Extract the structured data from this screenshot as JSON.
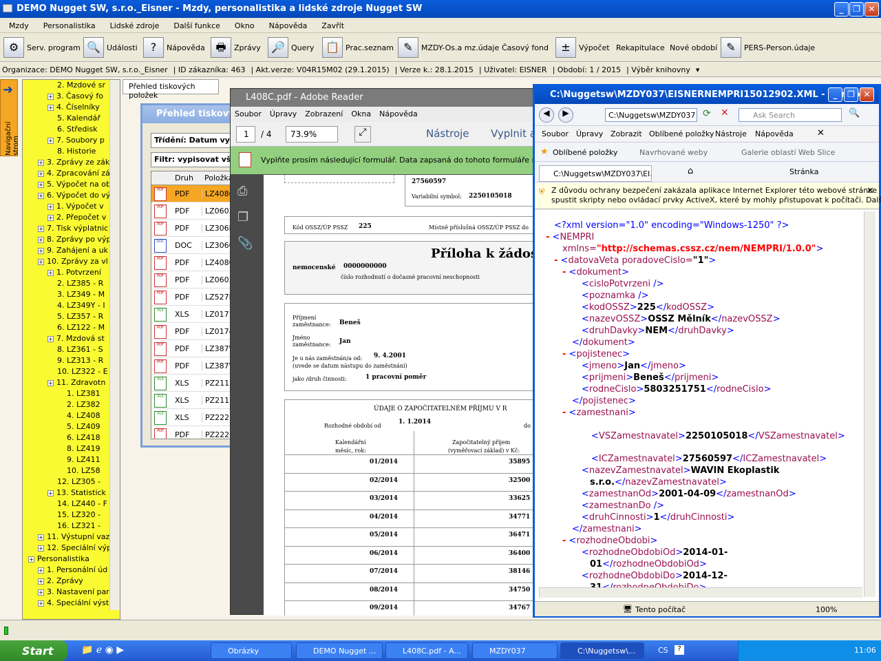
{
  "app": {
    "title": "DEMO Nugget SW, s.r.o._Eisner - Mzdy, personalistika a lidské zdroje Nugget SW"
  },
  "menu": [
    "Mzdy",
    "Personalistika",
    "Lidské zdroje",
    "Další funkce",
    "Okno",
    "Nápověda",
    "Zavřít"
  ],
  "toolbar": [
    "Serv. program",
    "Události",
    "Nápověda",
    "Zprávy",
    "Query",
    "Prac.seznam",
    "MZDY-Os.a mz.údaje",
    "Časový fond",
    "Výpočet",
    "Rekapitulace",
    "Nové období",
    "PERS-Person.údaje"
  ],
  "info": {
    "org": "Organizace: DEMO Nugget SW, s.r.o._Eisner",
    "id": "ID zákazníka: 463",
    "ver": "Akt.verze: V04R15M02 (29.1.2015)",
    "verk": "Verze k.: 28.1.2015",
    "user": "Uživatel: EISNER",
    "period": "Období: 1 / 2015",
    "lib": "Výběr knihovny"
  },
  "nav": {
    "strip": "Navigační strom"
  },
  "tree": [
    {
      "t": "2. Mzdové sr",
      "i": 3
    },
    {
      "t": "3. Časový fo",
      "i": 2
    },
    {
      "t": "4. Číselníky",
      "i": 2
    },
    {
      "t": "5. Kalendář",
      "i": 3
    },
    {
      "t": "6. Středisk",
      "i": 3
    },
    {
      "t": "7. Soubory p",
      "i": 2
    },
    {
      "t": "8. Historie",
      "i": 3
    },
    {
      "t": "3. Zprávy ze zák",
      "i": 1
    },
    {
      "t": "4. Zpracování zá",
      "i": 1
    },
    {
      "t": "5. Výpočet na ob",
      "i": 1
    },
    {
      "t": "6. Výpočet do vý",
      "i": 1
    },
    {
      "t": "1. Výpočet v",
      "i": 2
    },
    {
      "t": "2. Přepočet v",
      "i": 2
    },
    {
      "t": "7. Tisk výplatnic",
      "i": 1
    },
    {
      "t": "8. Zprávy po výp",
      "i": 1
    },
    {
      "t": "9. Zahájení a uk",
      "i": 1
    },
    {
      "t": "10. Zprávy za vl",
      "i": 1
    },
    {
      "t": "1. Potvrzení",
      "i": 2
    },
    {
      "t": "2. LZ385 - R",
      "i": 3
    },
    {
      "t": "3. LZ349 - M",
      "i": 3
    },
    {
      "t": "4. LZ349Y - I",
      "i": 3
    },
    {
      "t": "5. LZ357 - R",
      "i": 3
    },
    {
      "t": "6. LZ122 - M",
      "i": 3
    },
    {
      "t": "7. Mzdová st",
      "i": 2
    },
    {
      "t": "8. LZ361 - S",
      "i": 3
    },
    {
      "t": "9. LZ313 - R",
      "i": 3
    },
    {
      "t": "10. LZ322 - E",
      "i": 3
    },
    {
      "t": "11. Zdravotn",
      "i": 2
    },
    {
      "t": "1. LZ381",
      "i": 4
    },
    {
      "t": "2. LZ382",
      "i": 4
    },
    {
      "t": "4. LZ408",
      "i": 4
    },
    {
      "t": "5. LZ409",
      "i": 4
    },
    {
      "t": "6. LZ418",
      "i": 4
    },
    {
      "t": "8. LZ419",
      "i": 4
    },
    {
      "t": "9. LZ411",
      "i": 4
    },
    {
      "t": "10. LZ58",
      "i": 4
    },
    {
      "t": "12. LZ305 -",
      "i": 3
    },
    {
      "t": "13. Statistick",
      "i": 2
    },
    {
      "t": "14. LZ440 - F",
      "i": 3
    },
    {
      "t": "15. LZ320 -",
      "i": 3
    },
    {
      "t": "16. LZ321 -",
      "i": 3
    },
    {
      "t": "11. Výstupní vaz",
      "i": 1
    },
    {
      "t": "12. Speciální výp",
      "i": 1
    },
    {
      "t": "Personalistika",
      "i": 0
    },
    {
      "t": "1. Personální úd",
      "i": 1
    },
    {
      "t": "2. Zprávy",
      "i": 1
    },
    {
      "t": "3. Nastavení par",
      "i": 1
    },
    {
      "t": "4. Speciální výst",
      "i": 1
    }
  ],
  "tab": "Přehled tiskových položek",
  "prehled": {
    "title": "Přehled tiskových",
    "sort": "Třídění: Datum vy",
    "filter": "Filtr: vypisovat vše",
    "col_druh": "Druh",
    "col_polozka": "Položka",
    "rows": [
      {
        "ty": "PDF",
        "nm": "LZ408C"
      },
      {
        "ty": "PDF",
        "nm": "LZ0603"
      },
      {
        "ty": "PDF",
        "nm": "LZ306N"
      },
      {
        "ty": "DOC",
        "nm": "LZ3060"
      },
      {
        "ty": "PDF",
        "nm": "LZ408C"
      },
      {
        "ty": "PDF",
        "nm": "LZ0603"
      },
      {
        "ty": "PDF",
        "nm": "LZ527P"
      },
      {
        "ty": "XLS",
        "nm": "LZ0171"
      },
      {
        "ty": "PDF",
        "nm": "LZ0174"
      },
      {
        "ty": "PDF",
        "nm": "LZ387W"
      },
      {
        "ty": "PDF",
        "nm": "LZ387W"
      },
      {
        "ty": "XLS",
        "nm": "PZ2112"
      },
      {
        "ty": "XLS",
        "nm": "PZ2111"
      },
      {
        "ty": "XLS",
        "nm": "PZ2223"
      },
      {
        "ty": "PDF",
        "nm": "PZ222C"
      }
    ]
  },
  "pdf": {
    "title": "L408C.pdf - Adobe Reader",
    "menu": [
      "Soubor",
      "Úpravy",
      "Zobrazení",
      "Okna",
      "Nápověda"
    ],
    "page": "1",
    "of": "/ 4",
    "zoom": "73.9%",
    "tools": "Nástroje",
    "fill": "Vyplnit a",
    "formmsg": "Vyplňte prosím následující formulář. Data zapsaná do tohoto formuláře m",
    "doc": {
      "ico": "27560597",
      "vs_l": "Variabilní symbol:",
      "vs": "2250105018",
      "kod_l": "Kód OSSZ/ÚP PSSZ",
      "kod": "225",
      "mist": "Místně příslušná OSSZ/ÚP PSSZ do",
      "title": "Příloha k žádosti",
      "nem": "nemocenské",
      "nem_v": "0000000000",
      "rozh": "číslo rozhodnutí o dočasné pracovní neschopnosti",
      "prij_l": "Příjmení",
      "zam_l": "zaměstnance:",
      "prij": "Beneš",
      "jmeno_l": "Jméno",
      "jmeno": "Jan",
      "od_l": "Je u nás zaměstnán/a od:",
      "od": "9. 4.2001",
      "od2": "(uvede se datum nástupu do zaměstnání)",
      "cin_l": "jako /druh činnosti:",
      "cin": "1 pracovní poměr",
      "udaje": "ÚDAJE O ZAPOČITATELNÉM PŘÍJMU V R",
      "rozhod_l": "Rozhodné období od",
      "rozhod": "1. 1.2014",
      "do_l": "do",
      "kal1": "Kalendářní",
      "kal2": "měsíc, rok:",
      "zap1": "Započitatelný příjem",
      "zap2": "(vyměřovací základ) v Kč:",
      "rows": [
        {
          "m": "01/2014",
          "v": "35895"
        },
        {
          "m": "02/2014",
          "v": "32500"
        },
        {
          "m": "03/2014",
          "v": "33625"
        },
        {
          "m": "04/2014",
          "v": "34771"
        },
        {
          "m": "05/2014",
          "v": "36471"
        },
        {
          "m": "06/2014",
          "v": "36400"
        },
        {
          "m": "07/2014",
          "v": "38146"
        },
        {
          "m": "08/2014",
          "v": "34750"
        },
        {
          "m": "09/2014",
          "v": "34767"
        }
      ]
    }
  },
  "ie": {
    "title": "C:\\Nuggetsw\\MZDY037\\EISNERNEMPRI15012902.XML - Windo...",
    "addr": "C:\\Nuggetsw\\MZDY037",
    "search": "Ask Search",
    "menu": [
      "Soubor",
      "Úpravy",
      "Zobrazit",
      "Oblíbené položky",
      "Nástroje",
      "Nápověda"
    ],
    "fav": "Oblíbené položky",
    "sug": "Navrhované weby",
    "gal": "Galerie oblastí Web Slice",
    "tab": "C:\\Nuggetsw\\MZDY037\\EI...",
    "page": "Stránka",
    "warn1": "Z důvodu ochrany bezpečení zakázala aplikace Internet Explorer této webové stránce",
    "warn2": "spustit skripty nebo ovládací prvky ActiveX, které by mohly přistupovat k počítači. Další m...",
    "status": "Tento počítač",
    "zoom": "100%"
  },
  "xml": {
    "decl": "<?xml version=\"1.0\" encoding=\"Windows-1250\" ?>",
    "ns": "http://schemas.cssz.cz/nem/NEMPRI/1.0.0",
    "kodOSSZ": "225",
    "nazevOSSZ": "OSSZ Mělník",
    "druhDavky": "NEM",
    "jmeno": "Jan",
    "prijmeni": "Beneš",
    "rodneCislo": "5803251751",
    "vs": "2250105018",
    "ico": "27560597",
    "nazev1": "WAVIN Ekoplastik",
    "nazev2": "s.r.o.",
    "od": "2001-04-09",
    "druhCinnosti": "1",
    "rOd1": "2014-01-",
    "rOd2": "01",
    "rDo1": "2014-12-",
    "rDo2": "31"
  },
  "taskbar": {
    "start": "Start",
    "tasks": [
      "Obrázky",
      "DEMO Nugget ...",
      "L408C.pdf - A...",
      "MZDY037",
      "C:\\Nuggetsw\\..."
    ],
    "lang": "CS",
    "clock": "11:06"
  }
}
